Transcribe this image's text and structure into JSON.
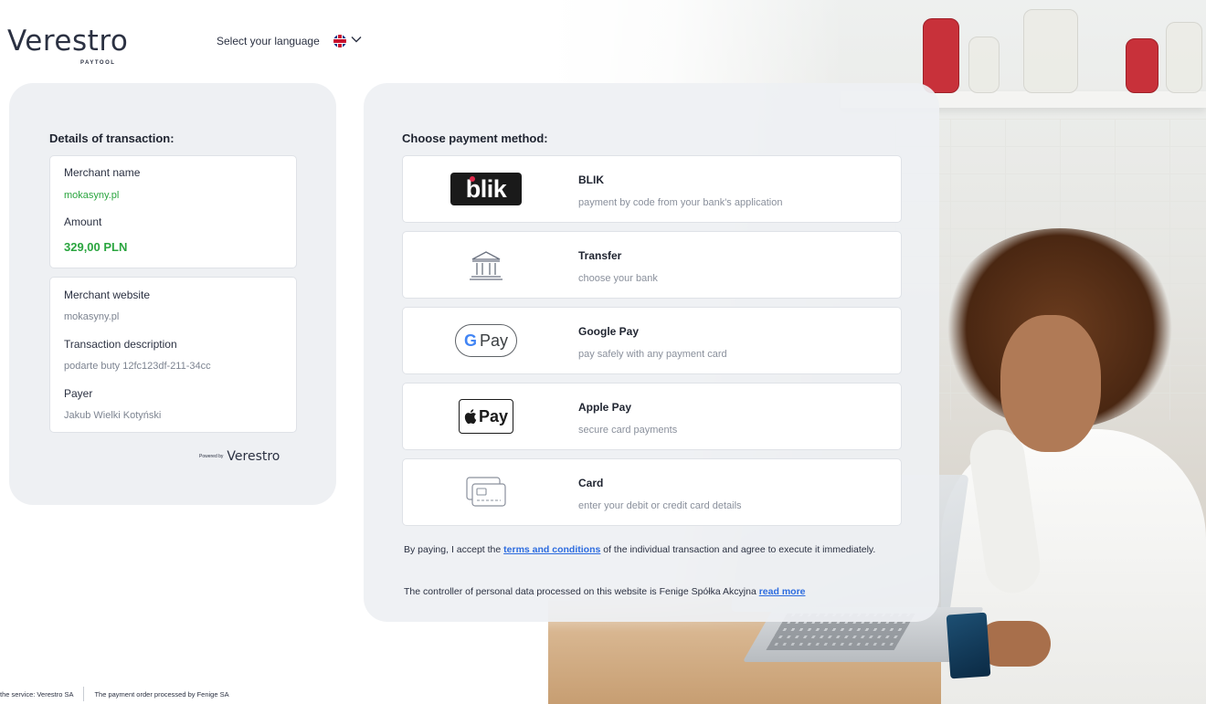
{
  "brand": {
    "name": "Verestro",
    "subtitle": "PAYTOOL"
  },
  "header": {
    "language_label": "Select your language",
    "language_icon": "uk-flag-icon"
  },
  "details": {
    "title": "Details of transaction:",
    "merchant_name_label": "Merchant name",
    "merchant_name_value": "mokasyny.pl",
    "amount_label": "Amount",
    "amount_value": "329,00 PLN",
    "merchant_website_label": "Merchant website",
    "merchant_website_value": "mokasyny.pl",
    "description_label": "Transaction description",
    "description_value": "podarte buty 12fc123df-211-34cc",
    "payer_label": "Payer",
    "payer_value": "Jakub Wielki Kotyński",
    "powered_label": "Powered by",
    "powered_brand": "Verestro"
  },
  "payment": {
    "title": "Choose payment method:",
    "methods": [
      {
        "title": "BLIK",
        "description": "payment by code from your bank's application",
        "icon": "blik-logo",
        "logo_text": "blik"
      },
      {
        "title": "Transfer",
        "description": "choose your bank",
        "icon": "bank-icon"
      },
      {
        "title": "Google Pay",
        "description": "pay safely with any payment card",
        "icon": "google-pay-logo",
        "logo_g": "G",
        "logo_text": "Pay"
      },
      {
        "title": "Apple Pay",
        "description": "secure card payments",
        "icon": "apple-pay-logo",
        "logo_text": "Pay"
      },
      {
        "title": "Card",
        "description": "enter your debit or credit card details",
        "icon": "credit-card-icon"
      }
    ],
    "terms_prefix": "By paying, I accept the ",
    "terms_link": "terms and conditions",
    "terms_suffix": " of the individual transaction and agree to execute it immediately.",
    "privacy_prefix": "The controller of personal data processed on this  website is Fenige Spółka Akcyjna ",
    "privacy_link": "read more"
  },
  "footer": {
    "service": "the service: Verestro SA",
    "processor": "The payment order processed by Fenige SA"
  },
  "colors": {
    "accent_green": "#2aa53f",
    "link_blue": "#2d6cdf",
    "panel_bg": "#eef0f3"
  }
}
